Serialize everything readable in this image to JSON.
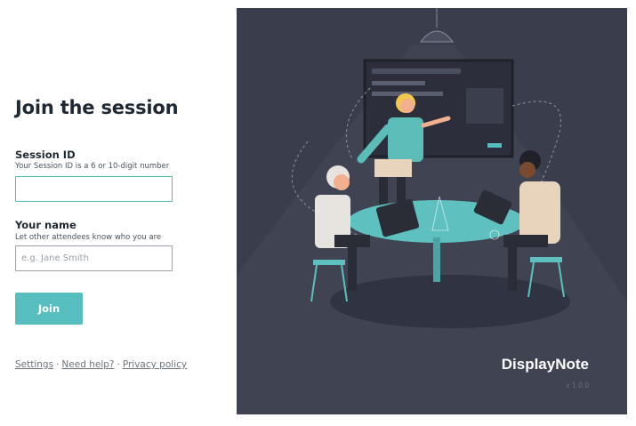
{
  "form": {
    "title": "Join the session",
    "session_id": {
      "label": "Session ID",
      "hint": "Your Session ID is a 6 or 10-digit number",
      "value": "",
      "placeholder": ""
    },
    "name": {
      "label": "Your name",
      "hint": "Let other attendees know who you are",
      "value": "",
      "placeholder": "e.g. Jane Smith"
    },
    "join_label": "Join"
  },
  "footer": {
    "settings": "Settings",
    "help": "Need help?",
    "privacy": "Privacy policy",
    "separator": "·"
  },
  "brand": {
    "name": "DisplayNote",
    "version": "v 1.0.0"
  },
  "colors": {
    "accent": "#56bebf",
    "panel_bg": "#3a3d4b"
  },
  "illustration": {
    "description_icon": "meeting-illustration"
  }
}
